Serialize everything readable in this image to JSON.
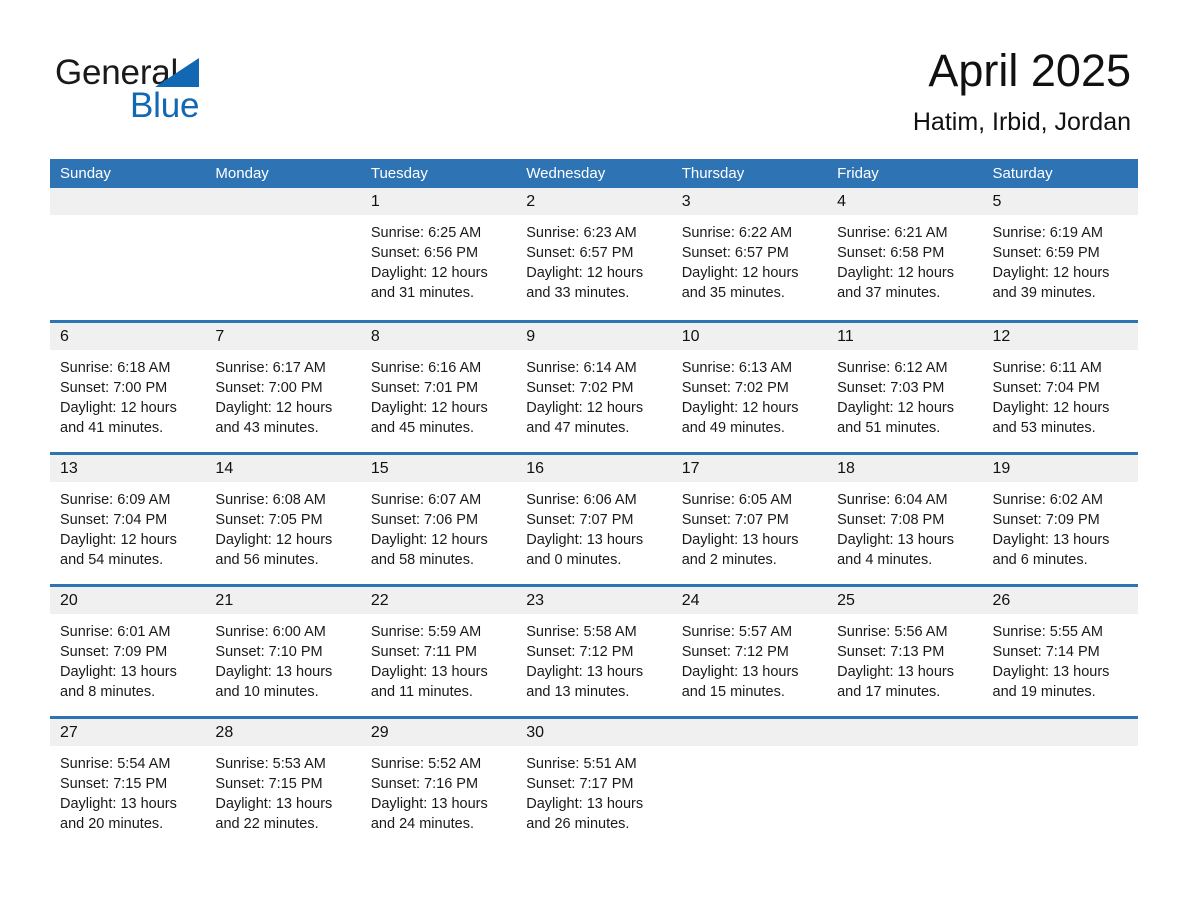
{
  "brand": {
    "name_part1": "General",
    "name_part2": "Blue",
    "triangle_color": "#1268b3"
  },
  "header": {
    "title": "April 2025",
    "location": "Hatim, Irbid, Jordan",
    "accent_color": "#2e74b5",
    "band_color": "#f0f0f0"
  },
  "weekdays": [
    "Sunday",
    "Monday",
    "Tuesday",
    "Wednesday",
    "Thursday",
    "Friday",
    "Saturday"
  ],
  "weeks": [
    [
      {
        "day": "",
        "sunrise": "",
        "sunset": "",
        "daylight_line1": "",
        "daylight_line2": "",
        "empty": true
      },
      {
        "day": "",
        "sunrise": "",
        "sunset": "",
        "daylight_line1": "",
        "daylight_line2": "",
        "empty": true
      },
      {
        "day": "1",
        "sunrise": "Sunrise: 6:25 AM",
        "sunset": "Sunset: 6:56 PM",
        "daylight_line1": "Daylight: 12 hours",
        "daylight_line2": "and 31 minutes."
      },
      {
        "day": "2",
        "sunrise": "Sunrise: 6:23 AM",
        "sunset": "Sunset: 6:57 PM",
        "daylight_line1": "Daylight: 12 hours",
        "daylight_line2": "and 33 minutes."
      },
      {
        "day": "3",
        "sunrise": "Sunrise: 6:22 AM",
        "sunset": "Sunset: 6:57 PM",
        "daylight_line1": "Daylight: 12 hours",
        "daylight_line2": "and 35 minutes."
      },
      {
        "day": "4",
        "sunrise": "Sunrise: 6:21 AM",
        "sunset": "Sunset: 6:58 PM",
        "daylight_line1": "Daylight: 12 hours",
        "daylight_line2": "and 37 minutes."
      },
      {
        "day": "5",
        "sunrise": "Sunrise: 6:19 AM",
        "sunset": "Sunset: 6:59 PM",
        "daylight_line1": "Daylight: 12 hours",
        "daylight_line2": "and 39 minutes."
      }
    ],
    [
      {
        "day": "6",
        "sunrise": "Sunrise: 6:18 AM",
        "sunset": "Sunset: 7:00 PM",
        "daylight_line1": "Daylight: 12 hours",
        "daylight_line2": "and 41 minutes."
      },
      {
        "day": "7",
        "sunrise": "Sunrise: 6:17 AM",
        "sunset": "Sunset: 7:00 PM",
        "daylight_line1": "Daylight: 12 hours",
        "daylight_line2": "and 43 minutes."
      },
      {
        "day": "8",
        "sunrise": "Sunrise: 6:16 AM",
        "sunset": "Sunset: 7:01 PM",
        "daylight_line1": "Daylight: 12 hours",
        "daylight_line2": "and 45 minutes."
      },
      {
        "day": "9",
        "sunrise": "Sunrise: 6:14 AM",
        "sunset": "Sunset: 7:02 PM",
        "daylight_line1": "Daylight: 12 hours",
        "daylight_line2": "and 47 minutes."
      },
      {
        "day": "10",
        "sunrise": "Sunrise: 6:13 AM",
        "sunset": "Sunset: 7:02 PM",
        "daylight_line1": "Daylight: 12 hours",
        "daylight_line2": "and 49 minutes."
      },
      {
        "day": "11",
        "sunrise": "Sunrise: 6:12 AM",
        "sunset": "Sunset: 7:03 PM",
        "daylight_line1": "Daylight: 12 hours",
        "daylight_line2": "and 51 minutes."
      },
      {
        "day": "12",
        "sunrise": "Sunrise: 6:11 AM",
        "sunset": "Sunset: 7:04 PM",
        "daylight_line1": "Daylight: 12 hours",
        "daylight_line2": "and 53 minutes."
      }
    ],
    [
      {
        "day": "13",
        "sunrise": "Sunrise: 6:09 AM",
        "sunset": "Sunset: 7:04 PM",
        "daylight_line1": "Daylight: 12 hours",
        "daylight_line2": "and 54 minutes."
      },
      {
        "day": "14",
        "sunrise": "Sunrise: 6:08 AM",
        "sunset": "Sunset: 7:05 PM",
        "daylight_line1": "Daylight: 12 hours",
        "daylight_line2": "and 56 minutes."
      },
      {
        "day": "15",
        "sunrise": "Sunrise: 6:07 AM",
        "sunset": "Sunset: 7:06 PM",
        "daylight_line1": "Daylight: 12 hours",
        "daylight_line2": "and 58 minutes."
      },
      {
        "day": "16",
        "sunrise": "Sunrise: 6:06 AM",
        "sunset": "Sunset: 7:07 PM",
        "daylight_line1": "Daylight: 13 hours",
        "daylight_line2": "and 0 minutes."
      },
      {
        "day": "17",
        "sunrise": "Sunrise: 6:05 AM",
        "sunset": "Sunset: 7:07 PM",
        "daylight_line1": "Daylight: 13 hours",
        "daylight_line2": "and 2 minutes."
      },
      {
        "day": "18",
        "sunrise": "Sunrise: 6:04 AM",
        "sunset": "Sunset: 7:08 PM",
        "daylight_line1": "Daylight: 13 hours",
        "daylight_line2": "and 4 minutes."
      },
      {
        "day": "19",
        "sunrise": "Sunrise: 6:02 AM",
        "sunset": "Sunset: 7:09 PM",
        "daylight_line1": "Daylight: 13 hours",
        "daylight_line2": "and 6 minutes."
      }
    ],
    [
      {
        "day": "20",
        "sunrise": "Sunrise: 6:01 AM",
        "sunset": "Sunset: 7:09 PM",
        "daylight_line1": "Daylight: 13 hours",
        "daylight_line2": "and 8 minutes."
      },
      {
        "day": "21",
        "sunrise": "Sunrise: 6:00 AM",
        "sunset": "Sunset: 7:10 PM",
        "daylight_line1": "Daylight: 13 hours",
        "daylight_line2": "and 10 minutes."
      },
      {
        "day": "22",
        "sunrise": "Sunrise: 5:59 AM",
        "sunset": "Sunset: 7:11 PM",
        "daylight_line1": "Daylight: 13 hours",
        "daylight_line2": "and 11 minutes."
      },
      {
        "day": "23",
        "sunrise": "Sunrise: 5:58 AM",
        "sunset": "Sunset: 7:12 PM",
        "daylight_line1": "Daylight: 13 hours",
        "daylight_line2": "and 13 minutes."
      },
      {
        "day": "24",
        "sunrise": "Sunrise: 5:57 AM",
        "sunset": "Sunset: 7:12 PM",
        "daylight_line1": "Daylight: 13 hours",
        "daylight_line2": "and 15 minutes."
      },
      {
        "day": "25",
        "sunrise": "Sunrise: 5:56 AM",
        "sunset": "Sunset: 7:13 PM",
        "daylight_line1": "Daylight: 13 hours",
        "daylight_line2": "and 17 minutes."
      },
      {
        "day": "26",
        "sunrise": "Sunrise: 5:55 AM",
        "sunset": "Sunset: 7:14 PM",
        "daylight_line1": "Daylight: 13 hours",
        "daylight_line2": "and 19 minutes."
      }
    ],
    [
      {
        "day": "27",
        "sunrise": "Sunrise: 5:54 AM",
        "sunset": "Sunset: 7:15 PM",
        "daylight_line1": "Daylight: 13 hours",
        "daylight_line2": "and 20 minutes."
      },
      {
        "day": "28",
        "sunrise": "Sunrise: 5:53 AM",
        "sunset": "Sunset: 7:15 PM",
        "daylight_line1": "Daylight: 13 hours",
        "daylight_line2": "and 22 minutes."
      },
      {
        "day": "29",
        "sunrise": "Sunrise: 5:52 AM",
        "sunset": "Sunset: 7:16 PM",
        "daylight_line1": "Daylight: 13 hours",
        "daylight_line2": "and 24 minutes."
      },
      {
        "day": "30",
        "sunrise": "Sunrise: 5:51 AM",
        "sunset": "Sunset: 7:17 PM",
        "daylight_line1": "Daylight: 13 hours",
        "daylight_line2": "and 26 minutes."
      },
      {
        "day": "",
        "sunrise": "",
        "sunset": "",
        "daylight_line1": "",
        "daylight_line2": "",
        "empty": true
      },
      {
        "day": "",
        "sunrise": "",
        "sunset": "",
        "daylight_line1": "",
        "daylight_line2": "",
        "empty": true
      },
      {
        "day": "",
        "sunrise": "",
        "sunset": "",
        "daylight_line1": "",
        "daylight_line2": "",
        "empty": true
      }
    ]
  ]
}
